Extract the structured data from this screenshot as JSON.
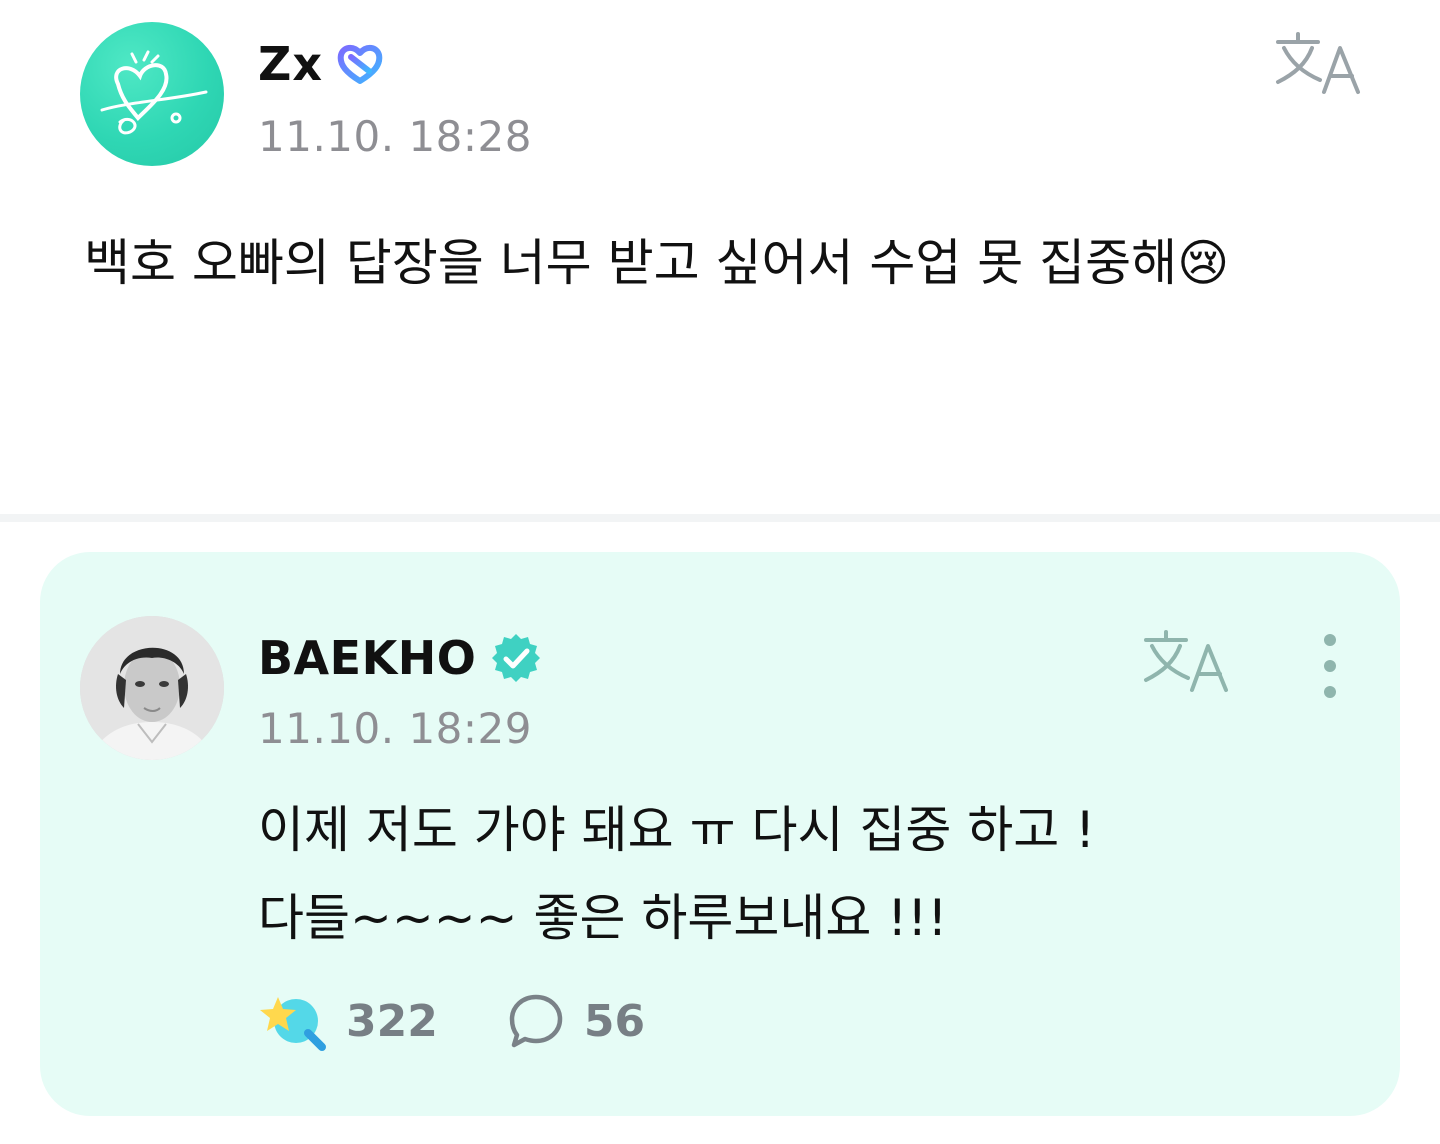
{
  "post": {
    "author": "Zx",
    "timestamp": "11.10. 18:28",
    "text": "백호 오빠의 답장을 너무 받고 싶어서 수업 못 집중해😢",
    "avatar_icon": "fan-heart-signature-avatar",
    "badge_icon": "fan-membership-badge-icon",
    "translate_icon": "translate-icon"
  },
  "reply": {
    "author": "BAEKHO",
    "timestamp": "11.10. 18:29",
    "lines": [
      "이제 저도 가야 돼요 ㅠ 다시 집중 하고 !",
      "다들~~~~ 좋은 하루보내요 !!!"
    ],
    "likes": "322",
    "comments": "56",
    "avatar_icon": "artist-photo-avatar",
    "badge_icon": "verified-badge-icon",
    "translate_icon": "translate-icon",
    "more_icon": "more-vertical-icon"
  },
  "colors": {
    "card_background": "#e6fcf6",
    "verified": "#3fd1c2",
    "fan_avatar": "#2fd7b4",
    "muted": "#8e8e93"
  }
}
